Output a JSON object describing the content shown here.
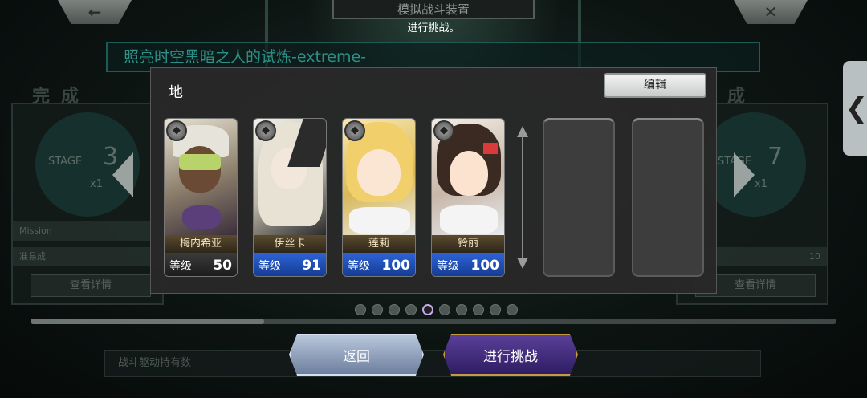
{
  "header": {
    "back_icon": "←",
    "close_icon": "✕",
    "title": "模拟战斗装置",
    "hint": "进行挑战。"
  },
  "stage_banner": "照亮时空黑暗之人的试炼-extreme-",
  "background_cards": {
    "left": {
      "complete": "完成",
      "stage_label": "STAGE",
      "stage_num": "3",
      "multiplier": "x1",
      "mission": "Mission",
      "status": "准易成",
      "detail": "查看详情"
    },
    "right": {
      "complete": "成",
      "stage_label": "STAGE",
      "stage_num": "7",
      "multiplier": "x1",
      "extra": "10",
      "detail": "查看详情"
    }
  },
  "side_tab_icon": "❮",
  "dialog": {
    "element": "地",
    "edit_label": "编辑",
    "units": [
      {
        "name": "梅内希亚",
        "level_label": "等级",
        "level": "50",
        "bar": "dark",
        "badge_icon": "element-badge-icon"
      },
      {
        "name": "伊丝卡",
        "level_label": "等级",
        "level": "91",
        "bar": "blue",
        "badge_icon": "element-badge-icon"
      },
      {
        "name": "莲莉",
        "level_label": "等级",
        "level": "100",
        "bar": "blue",
        "badge_icon": "element-badge-icon"
      },
      {
        "name": "铃丽",
        "level_label": "等级",
        "level": "100",
        "bar": "blue",
        "badge_icon": "element-badge-icon"
      }
    ],
    "empty_slots": 2
  },
  "pager": {
    "count": 10,
    "active_index": 4
  },
  "progress": {
    "fraction": 0.29
  },
  "bottom_bar_text": "战斗躯动持有数",
  "buttons": {
    "back": "返回",
    "challenge": "进行挑战"
  },
  "colors": {
    "banner_text": "#2f8f86",
    "challenge_bg": "#3d2a7a",
    "challenge_border": "#c79a3f",
    "level_blue": "#2e64d6"
  }
}
